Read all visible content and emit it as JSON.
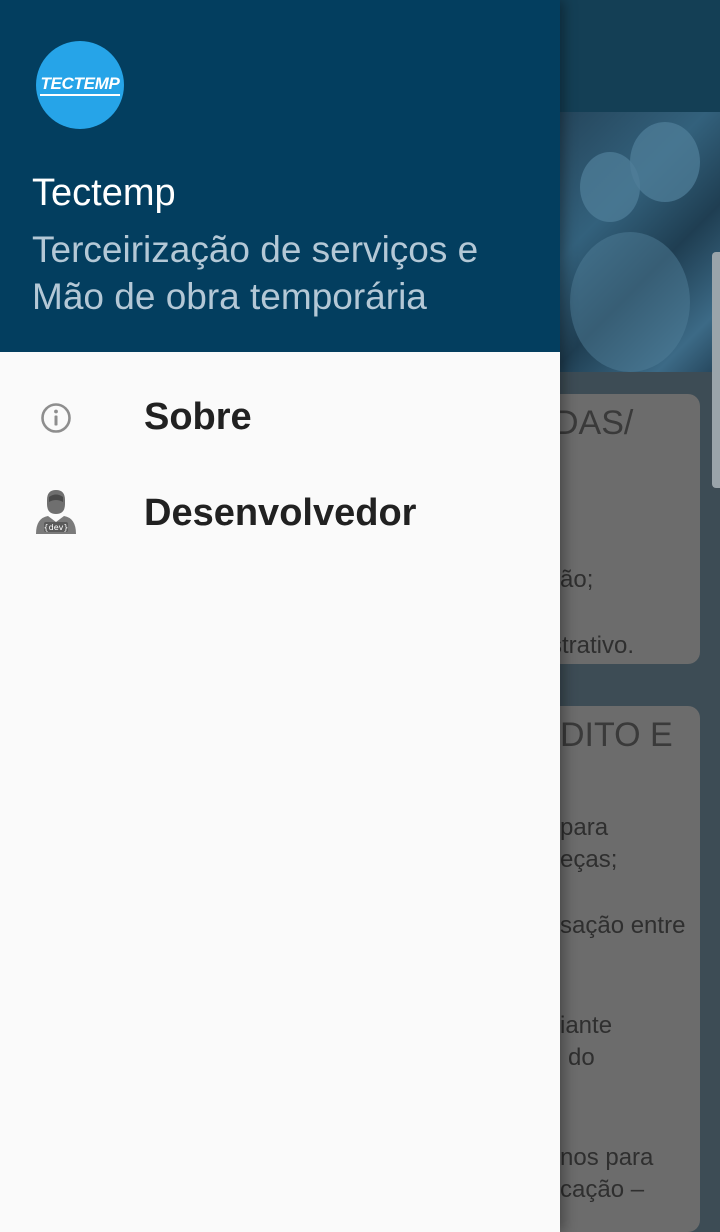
{
  "drawer": {
    "logo_text": "TECTEMP",
    "app_name": "Tectemp",
    "app_subtitle": "Terceirização de serviços e Mão de obra temporária",
    "items": [
      {
        "label": "Sobre",
        "icon": "info-icon"
      },
      {
        "label": "Desenvolvedor",
        "icon": "developer-avatar-icon",
        "icon_badge": "{dev}"
      }
    ]
  },
  "background": {
    "card1": {
      "title": "DAS/",
      "line1": "ão;",
      "line2": "strativo."
    },
    "card2": {
      "title": "DITO E",
      "lines": [
        "para",
        "eças;",
        "sação entre",
        "iante",
        "do",
        "nos para",
        "cação –"
      ]
    }
  },
  "colors": {
    "header_bg": "#033e5f",
    "logo_bg": "#26a4e8",
    "drawer_bg": "#fafafa",
    "subtitle": "#b4c8d6"
  }
}
